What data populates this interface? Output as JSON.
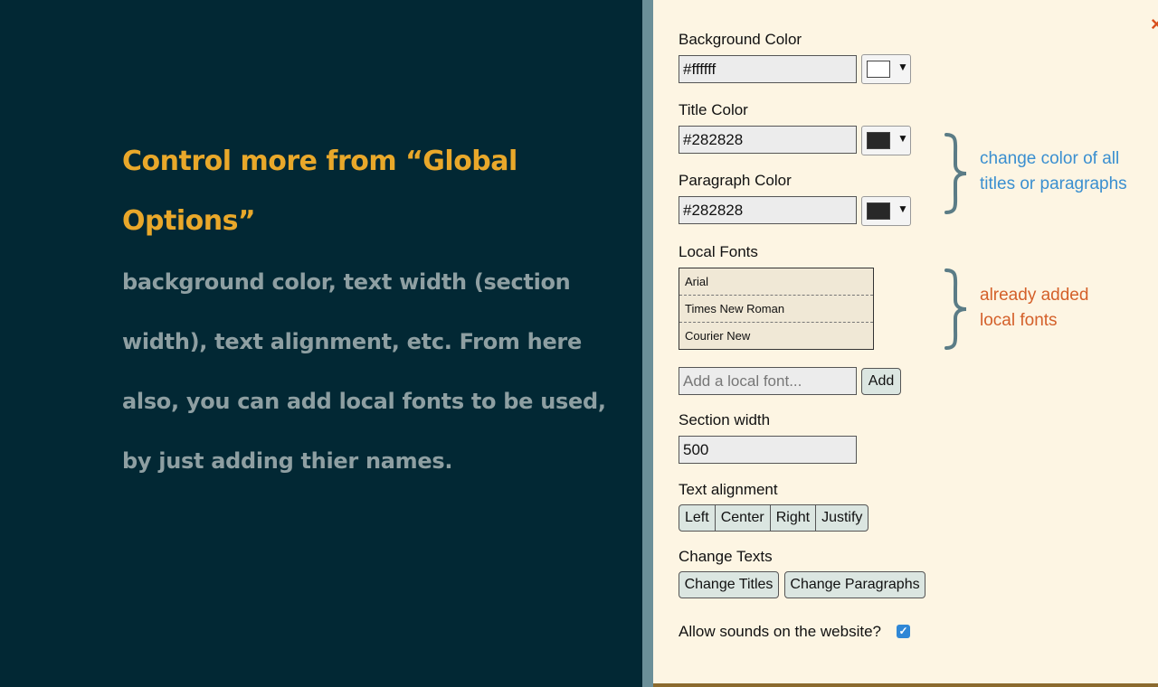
{
  "slide": {
    "title": "Control more from “Global Options”",
    "body": "background color, text width (section width), text alignment, etc. From here also, you can add local fonts to be used, by just adding thier names."
  },
  "panel": {
    "close_label": "×",
    "background_color": {
      "label": "Background Color",
      "value": "#ffffff",
      "swatch": "#ffffff"
    },
    "title_color": {
      "label": "Title Color",
      "value": "#282828",
      "swatch": "#282828"
    },
    "paragraph_color": {
      "label": "Paragraph Color",
      "value": "#282828",
      "swatch": "#282828"
    },
    "local_fonts": {
      "label": "Local Fonts",
      "items": [
        "Arial",
        "Times New Roman",
        "Courier New"
      ]
    },
    "add_font": {
      "placeholder": "Add a local font...",
      "button_label": "Add"
    },
    "section_width": {
      "label": "Section width",
      "value": "500"
    },
    "text_alignment": {
      "label": "Text alignment",
      "options": [
        "Left",
        "Center",
        "Right",
        "Justify"
      ]
    },
    "change_texts": {
      "label": "Change Texts",
      "buttons": [
        "Change Titles",
        "Change Paragraphs"
      ]
    },
    "sounds": {
      "label": "Allow sounds on the website?",
      "checked": true
    },
    "dropdown_arrow": "▼"
  },
  "annotations": {
    "colors_note": {
      "line1": "change color of all",
      "line2": "titles or paragraphs",
      "color": "#3a8fd0"
    },
    "fonts_note": {
      "line1": "already added",
      "line2": "local fonts",
      "color": "#d4602a"
    }
  },
  "colors": {
    "background": "#022834",
    "title": "#e9a82a",
    "body": "#8e9fa2",
    "panel": "#fdf5e3",
    "accent": "#d9501e"
  }
}
